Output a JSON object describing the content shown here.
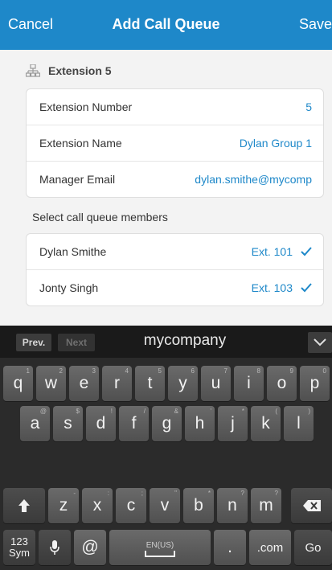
{
  "header": {
    "cancel_label": "Cancel",
    "title": "Add Call Queue",
    "save_label": "Save"
  },
  "section": {
    "title": "Extension 5",
    "icon": "hierarchy-icon"
  },
  "details": [
    {
      "label": "Extension Number",
      "value": "5"
    },
    {
      "label": "Extension Name",
      "value": "Dylan Group 1"
    },
    {
      "label": "Manager Email",
      "value": "dylan.smithe@mycomp"
    }
  ],
  "members_label": "Select call queue members",
  "members": [
    {
      "name": "Dylan Smithe",
      "ext": "Ext. 101",
      "checked": true
    },
    {
      "name": "Jonty Singh",
      "ext": "Ext. 103",
      "checked": true
    }
  ],
  "keyboard": {
    "prev_label": "Prev.",
    "next_label": "Next",
    "suggestion": "mycompany",
    "row1": [
      {
        "k": "q",
        "s": "1"
      },
      {
        "k": "w",
        "s": "2"
      },
      {
        "k": "e",
        "s": "3"
      },
      {
        "k": "r",
        "s": "4"
      },
      {
        "k": "t",
        "s": "5"
      },
      {
        "k": "y",
        "s": "6"
      },
      {
        "k": "u",
        "s": "7"
      },
      {
        "k": "i",
        "s": "8"
      },
      {
        "k": "o",
        "s": "9"
      },
      {
        "k": "p",
        "s": "0"
      }
    ],
    "row2": [
      {
        "k": "a",
        "s": "@"
      },
      {
        "k": "s",
        "s": "$"
      },
      {
        "k": "d",
        "s": "!"
      },
      {
        "k": "f",
        "s": "/"
      },
      {
        "k": "g",
        "s": "&"
      },
      {
        "k": "h",
        "s": "'"
      },
      {
        "k": "j",
        "s": "*"
      },
      {
        "k": "k",
        "s": "("
      },
      {
        "k": "l",
        "s": ")"
      }
    ],
    "row3": [
      {
        "k": "z",
        "s": "-"
      },
      {
        "k": "x",
        "s": ":"
      },
      {
        "k": "c",
        "s": ";"
      },
      {
        "k": "v",
        "s": "\""
      },
      {
        "k": "b",
        "s": "*"
      },
      {
        "k": "n",
        "s": "?"
      },
      {
        "k": "m",
        "s": "?"
      }
    ],
    "sym_label_1": "123",
    "sym_label_2": "Sym",
    "at_label": "@",
    "space_label": "EN(US)",
    "dot_label": ".",
    "com_label": ".com",
    "go_label": "Go"
  },
  "colors": {
    "accent": "#1e88c9",
    "background": "#f3f3f3",
    "keyboard": "#2b2b2b"
  }
}
